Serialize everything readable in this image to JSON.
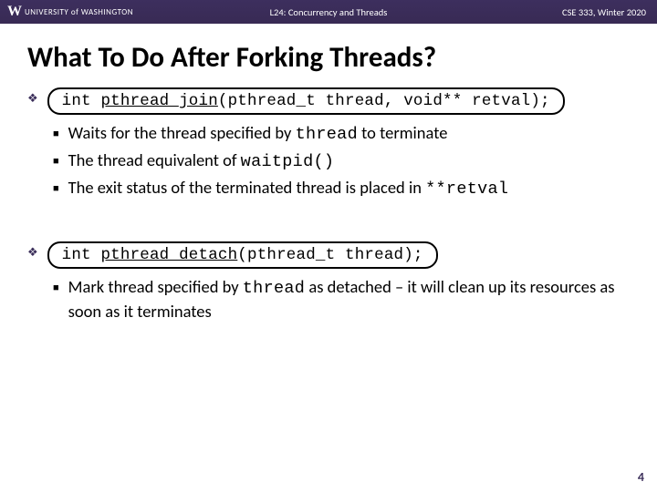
{
  "header": {
    "logo_w": "W",
    "logo_text": "UNIVERSITY of WASHINGTON",
    "lecture": "L24: Concurrency and Threads",
    "course": "CSE 333, Winter 2020"
  },
  "title": "What To Do After Forking Threads?",
  "sec1": {
    "code_pre": "int ",
    "code_fn": "pthread_join",
    "code_post": "(pthread_t thread, void** retval);",
    "b1_pre": "Waits for the thread specified by ",
    "b1_code": "thread",
    "b1_post": " to terminate",
    "b2_pre": "The thread equivalent of ",
    "b2_code": "waitpid()",
    "b3_pre": "The exit status of the terminated thread is placed in ",
    "b3_code": "**retval"
  },
  "sec2": {
    "code_pre": "int ",
    "code_fn": "pthread_detach",
    "code_post": "(pthread_t thread);",
    "b1_pre": "Mark thread specified by ",
    "b1_code": "thread",
    "b1_post": " as detached – it will clean up its resources as soon as it terminates"
  },
  "page_number": "4"
}
